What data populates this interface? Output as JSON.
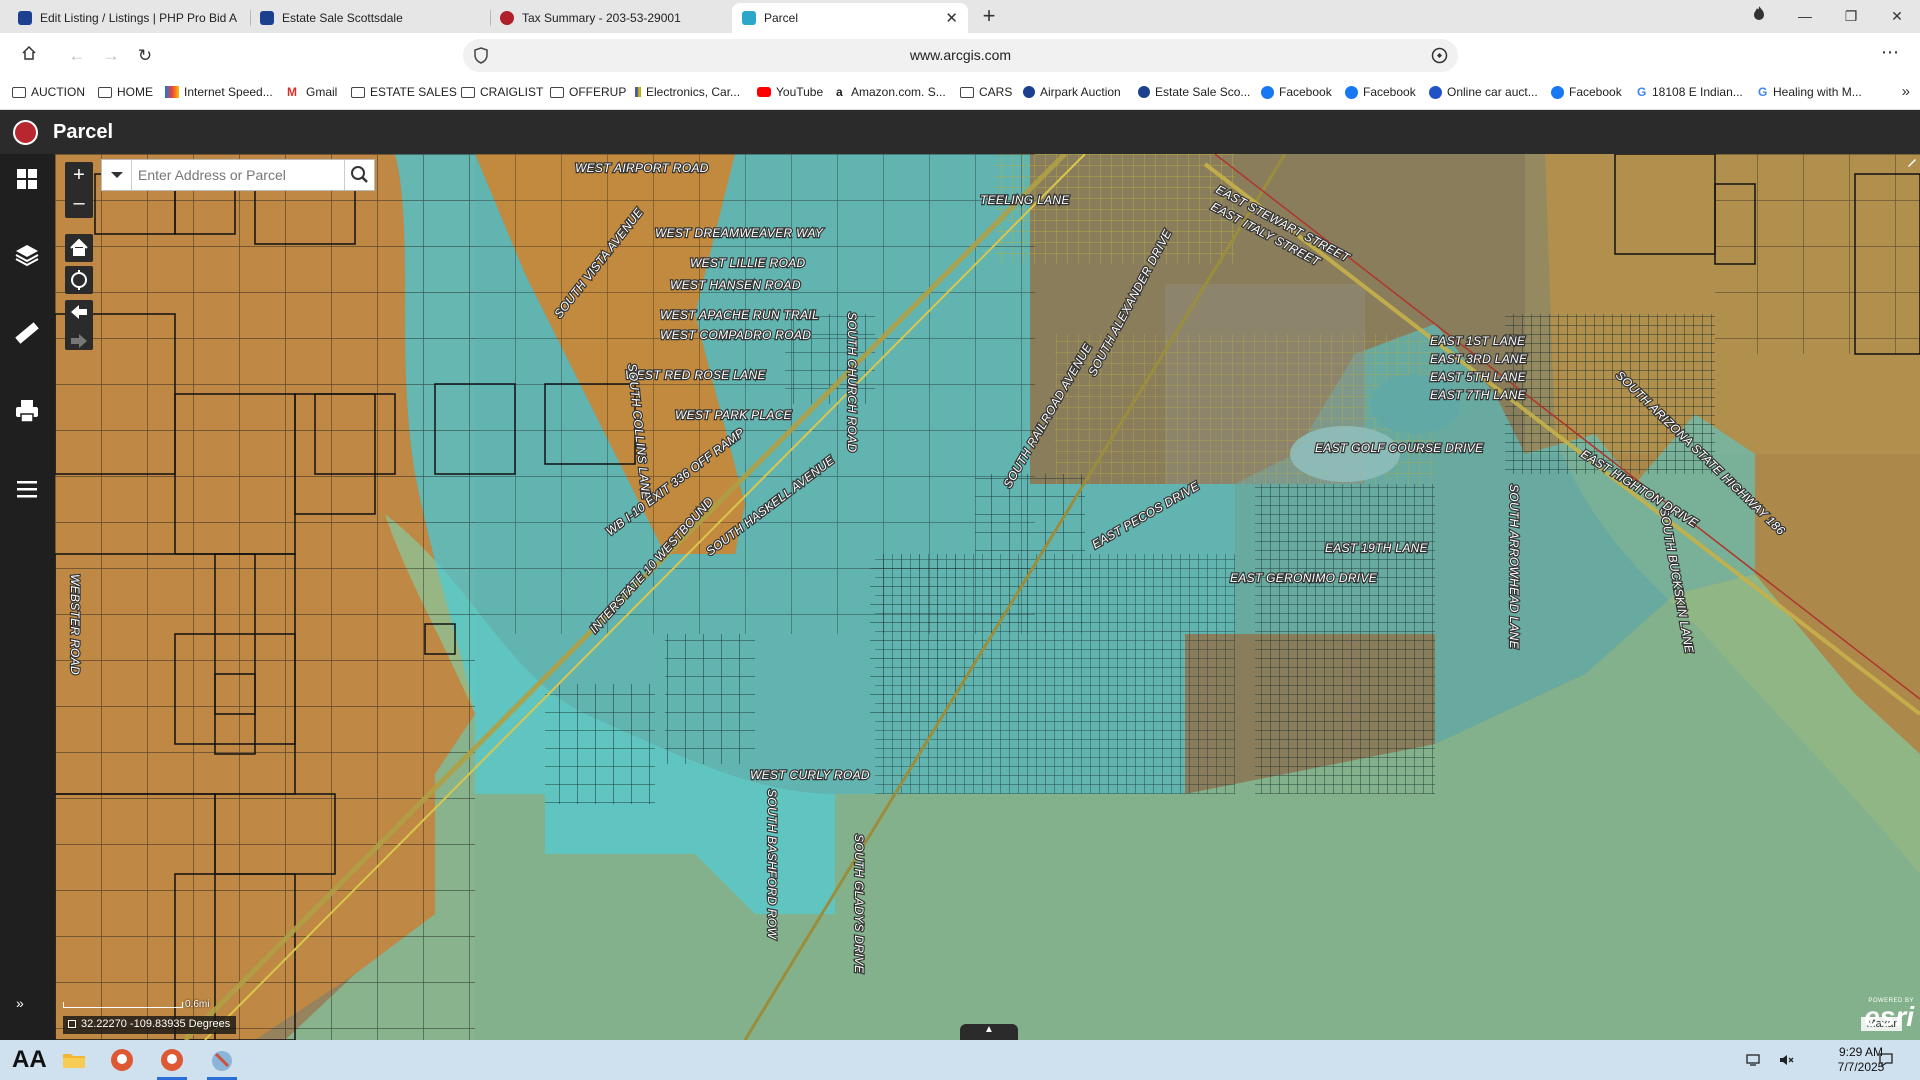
{
  "browser": {
    "tabs": [
      {
        "label": "Edit Listing / Listings | PHP Pro Bid A",
        "favicon_color": "#1d3f8f",
        "active": false
      },
      {
        "label": "Estate Sale Scottsdale",
        "favicon_color": "#1d3f8f",
        "active": false
      },
      {
        "label": "Tax Summary - 203-53-29001",
        "favicon_color": "#b0202a",
        "active": false
      },
      {
        "label": "Parcel",
        "favicon_color": "#2aa7c9",
        "active": true
      }
    ],
    "new_tab_icon": "plus-icon",
    "url": "www.arcgis.com",
    "bookmarks": [
      {
        "label": "AUCTION",
        "icon": "folder-icon"
      },
      {
        "label": "HOME",
        "icon": "folder-icon"
      },
      {
        "label": "Internet Speed...",
        "icon": "speedtest-icon"
      },
      {
        "label": "Gmail",
        "icon": "gmail-icon"
      },
      {
        "label": "ESTATE SALES",
        "icon": "folder-icon"
      },
      {
        "label": "CRAIGLIST",
        "icon": "folder-icon"
      },
      {
        "label": "OFFERUP",
        "icon": "folder-icon"
      },
      {
        "label": "Electronics, Car...",
        "icon": "ebay-icon"
      },
      {
        "label": "YouTube",
        "icon": "youtube-icon"
      },
      {
        "label": "Amazon.com. S...",
        "icon": "amazon-icon"
      },
      {
        "label": "CARS",
        "icon": "folder-icon"
      },
      {
        "label": "Airpark Auction",
        "icon": "site-icon"
      },
      {
        "label": "Estate Sale Sco...",
        "icon": "site-icon"
      },
      {
        "label": "Facebook",
        "icon": "facebook-icon"
      },
      {
        "label": "Facebook",
        "icon": "facebook-icon"
      },
      {
        "label": "Online car auct...",
        "icon": "site-icon"
      },
      {
        "label": "Facebook",
        "icon": "facebook-icon"
      },
      {
        "label": "18108 E Indian...",
        "icon": "google-icon"
      },
      {
        "label": "Healing with M...",
        "icon": "google-icon"
      }
    ]
  },
  "app": {
    "title": "Parcel",
    "search": {
      "placeholder": "Enter Address or Parcel",
      "value": ""
    },
    "zoom": {
      "in": "+",
      "out": "–"
    },
    "scale_label": "0.6mi",
    "coordinates": "32.22270 -109.83935 Degrees",
    "attribution": "Maxar",
    "esri_powered": "POWERED BY",
    "esri_brand": "esri",
    "colors": {
      "header": "#2b2b2b",
      "rail": "#1f1f1f",
      "zone_orange": "#d98c32",
      "zone_cyan": "#58d4dc",
      "zone_green": "#7fd0a8"
    },
    "road_labels": [
      "WEST AIRPORT ROAD",
      "WEST DREAMWEAVER WAY",
      "WEST LILLIE ROAD",
      "WEST HANSEN ROAD",
      "WEST APACHE RUN TRAIL",
      "WEST COMPADRO ROAD",
      "WEST RED ROSE LANE",
      "WEST PARK PLACE",
      "SOUTH VISTA AVENUE",
      "SOUTH COLLINS LANE",
      "WB I-10 EXIT 336 OFF RAMP",
      "INTERSTATE 10 WESTBOUND",
      "SOUTH HASKELL AVENUE",
      "SOUTH CHURCH ROAD",
      "SOUTH RAILROAD AVENUE",
      "SOUTH ALEXANDER DRIVE",
      "TEELING LANE",
      "EAST STEWART STREET",
      "EAST ITALY STREET",
      "EAST 1ST LANE",
      "EAST 3RD LANE",
      "EAST 5TH LANE",
      "EAST 7TH LANE",
      "EAST GOLF COURSE DRIVE",
      "EAST PECOS DRIVE",
      "EAST 19TH LANE",
      "EAST GERONIMO DRIVE",
      "SOUTH ARROWHEAD LANE",
      "SOUTH BUCKSKIN LANE",
      "EAST HIGHTON DRIVE",
      "SOUTH ARIZONA STATE HIGHWAY 186",
      "WEST CURLY ROAD",
      "SOUTH BASHFORD ROW",
      "SOUTH GLADYS DRIVE",
      "WEBSTER ROAD"
    ]
  },
  "taskbar": {
    "time": "9:29 AM",
    "date": "7/7/2025",
    "aa_label": "AA"
  }
}
